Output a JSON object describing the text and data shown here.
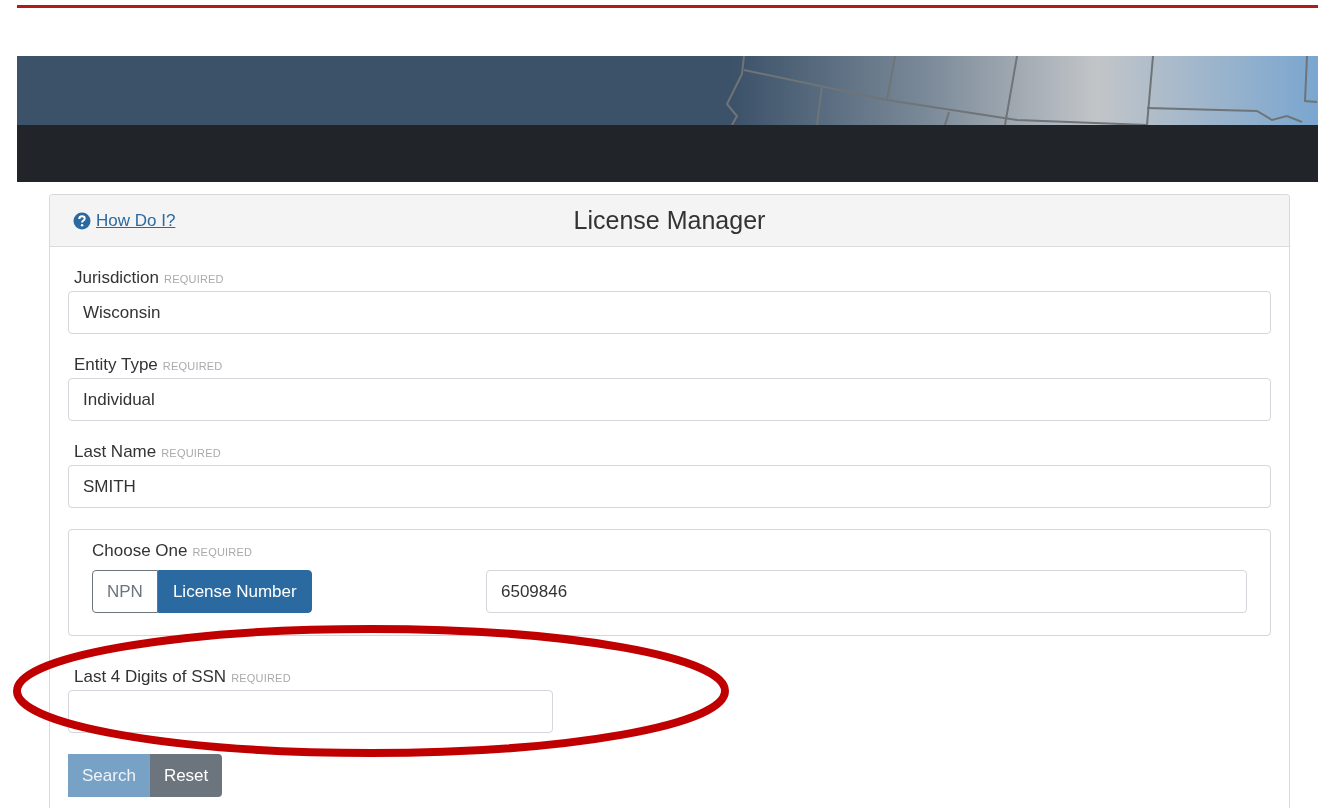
{
  "panel": {
    "help_link": "How Do I?",
    "title": "License Manager"
  },
  "fields": [
    {
      "label": "Jurisdiction",
      "required_tag": "REQUIRED",
      "value": "Wisconsin"
    },
    {
      "label": "Entity Type",
      "required_tag": "REQUIRED",
      "value": "Individual"
    },
    {
      "label": "Last Name",
      "required_tag": "REQUIRED",
      "value": "SMITH"
    }
  ],
  "choose_one": {
    "label": "Choose One",
    "required_tag": "REQUIRED",
    "options": [
      {
        "label": "NPN",
        "selected": false
      },
      {
        "label": "License Number",
        "selected": true
      }
    ],
    "value": "6509846"
  },
  "ssn_field": {
    "label": "Last 4 Digits of SSN",
    "required_tag": "REQUIRED"
  },
  "buttons": [
    {
      "label": "Search",
      "kind": "primary",
      "disabled": true
    },
    {
      "label": "Reset",
      "kind": "secondary",
      "disabled": false
    }
  ],
  "annotation": {
    "kind": "ellipse"
  }
}
